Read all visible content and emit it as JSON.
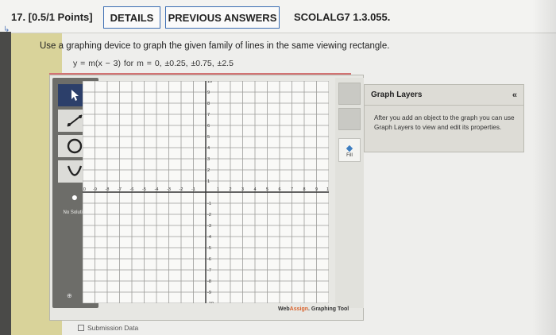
{
  "header": {
    "question": "17. [0.5/1 Points]",
    "details_label": "DETAILS",
    "previous_answers_label": "PREVIOUS ANSWERS",
    "problem_code": "SCOLALG7 1.3.055."
  },
  "problem": {
    "instruction": "Use a graphing device to graph the given family of lines in the same viewing rectangle.",
    "equation": "y = m(x − 3)    for m = 0, ±0.25, ±0.75, ±2.5"
  },
  "graph_tool": {
    "tools": [
      "pointer-icon",
      "line-icon",
      "circle-icon",
      "parabola-icon",
      "point-icon"
    ],
    "no_solution_label": "No Solution",
    "fill_label": "Fill",
    "brand_prefix": "Web",
    "brand_accent": "Assign",
    "brand_suffix": ". Graphing Tool",
    "x_ticks": [
      "-10",
      "-9",
      "-8",
      "-7",
      "-6",
      "-5",
      "-4",
      "-3",
      "-2",
      "-1",
      "1",
      "2",
      "3",
      "4",
      "5",
      "6",
      "7",
      "8",
      "9",
      "10"
    ],
    "y_ticks": [
      "10",
      "9",
      "8",
      "7",
      "6",
      "5",
      "4",
      "3",
      "2",
      "1",
      "-1",
      "-2",
      "-3",
      "-4",
      "-5",
      "-6",
      "-7",
      "-8",
      "-9",
      "-10"
    ]
  },
  "layers_panel": {
    "title": "Graph Layers",
    "collapse_icon": "«",
    "body": "After you add an object to the graph you can use Graph Layers to view and edit its properties."
  },
  "footer": {
    "submission_label": "Submission Data"
  },
  "colors": {
    "button_border": "#3b6db3",
    "toolbar": "#6d6d69",
    "active_tool": "#2c3f6a",
    "accent": "#d9622c"
  }
}
